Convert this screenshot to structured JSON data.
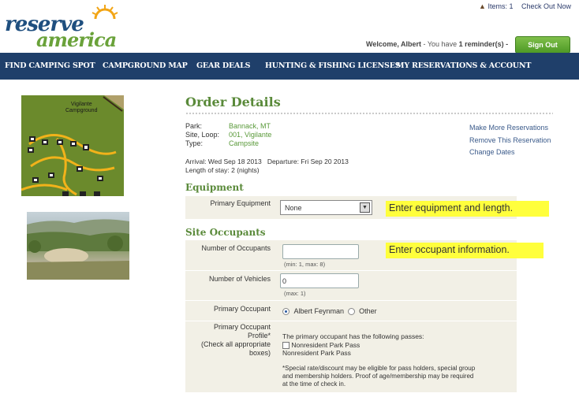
{
  "top": {
    "items_label": "Items: 1",
    "checkout_label": "Check Out Now"
  },
  "logo": {
    "word1": "reserve",
    "word2": "america",
    "tm": "™"
  },
  "welcome": {
    "prefix": "Welcome, Albert",
    "reminder_prefix": " - You have ",
    "reminder_count": "1",
    "reminder_suffix": " reminder(s) -",
    "sign_out": "Sign Out"
  },
  "nav": [
    "FIND CAMPING SPOT",
    "CAMPGROUND MAP",
    "GEAR DEALS",
    "HUNTING & FISHING LICENSES",
    "MY RESERVATIONS & ACCOUNT"
  ],
  "map": {
    "label_line1": "Vigilante",
    "label_line2": "Campground"
  },
  "order": {
    "title": "Order Details",
    "park_label": "Park:",
    "park_value": "Bannack, MT",
    "site_label": "Site, Loop:",
    "site_value": "001, Vigilante",
    "type_label": "Type:",
    "type_value": "Campsite",
    "arrival": "Arrival: Wed Sep 18 2013",
    "departure": "Departure: Fri Sep 20 2013",
    "length": "Length of stay: 2 (nights)",
    "links": [
      "Make More Reservations",
      "Remove This Reservation",
      "Change Dates"
    ]
  },
  "equipment": {
    "heading": "Equipment",
    "primary_label": "Primary Equipment",
    "primary_value": "None",
    "note": "Enter equipment and length."
  },
  "occupants": {
    "heading": "Site Occupants",
    "note": "Enter occupant information.",
    "num_label": "Number of Occupants",
    "num_value": "",
    "num_hint": "(min: 1, max: 8)",
    "veh_label": "Number of Vehicles",
    "veh_value": "0",
    "veh_hint": "(max: 1)",
    "primary_label": "Primary Occupant",
    "primary_option1": "Albert Feynman",
    "primary_option2": "Other",
    "profile_label_l1": "Primary Occupant",
    "profile_label_l2": "Profile*",
    "profile_label_l3": "(Check all appropriate",
    "profile_label_l4": "boxes)",
    "passes_intro": "The primary occupant has the following passes:",
    "pass_checkbox": "Nonresident Park Pass",
    "pass_text": "Nonresident Park Pass",
    "disclaimer_l1": "*Special rate/discount may be eligible for pass holders, special group",
    "disclaimer_l2": "and membership holders. Proof of age/membership may be required",
    "disclaimer_l3": "at the time of check in."
  },
  "colors": {
    "nav_bg": "#1f3f6a",
    "accent_green": "#5a8a3a",
    "highlight": "#ffff3c"
  }
}
